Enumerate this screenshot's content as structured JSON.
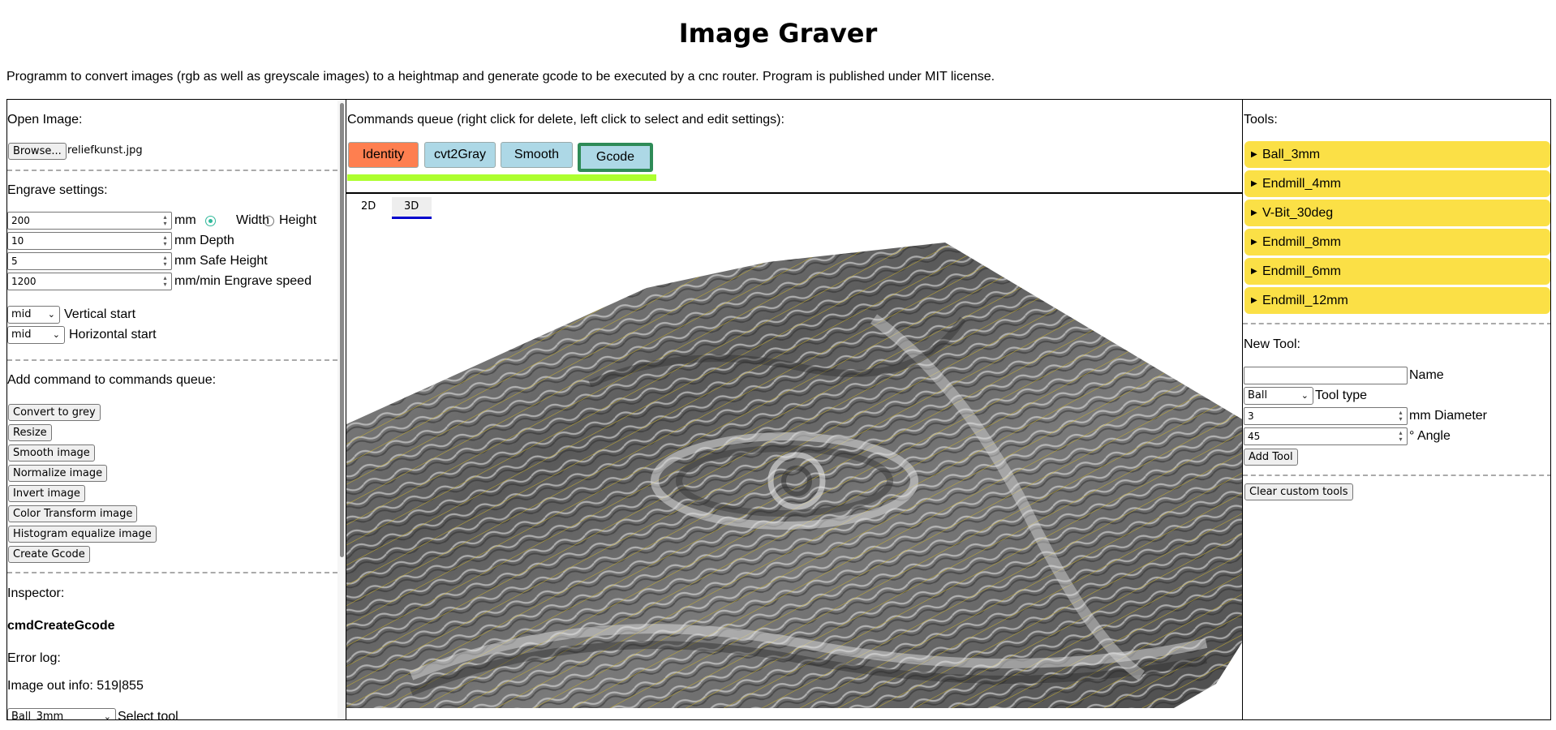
{
  "title": "Image Graver",
  "description": "Programm to convert images (rgb as well as greyscale images) to a heightmap and generate gcode to be executed by a cnc router. Program is published under MIT license.",
  "left": {
    "open_image_label": "Open Image:",
    "browse_label": "Browse...",
    "file_name": "reliefkunst.jpg",
    "engrave_settings_label": "Engrave settings:",
    "size_value": "200",
    "size_unit": "mm",
    "width_label": "Width",
    "height_label": "Height",
    "depth_value": "10",
    "depth_label": "mm Depth",
    "safe_height_value": "5",
    "safe_height_label": "mm Safe Height",
    "speed_value": "1200",
    "speed_label": "mm/min Engrave speed",
    "vertical_start_value": "mid",
    "vertical_start_label": "Vertical start",
    "horizontal_start_value": "mid",
    "horizontal_start_label": "Horizontal start",
    "add_command_label": "Add command to commands queue:",
    "commands": [
      "Convert to grey",
      "Resize",
      "Smooth image",
      "Normalize image",
      "Invert image",
      "Color Transform image",
      "Histogram equalize image",
      "Create Gcode"
    ],
    "inspector_label": "Inspector:",
    "inspector_cmd": "cmdCreateGcode",
    "error_log_label": "Error log:",
    "image_out_info": "Image out info: 519|855",
    "select_tool_value": "Ball_3mm",
    "select_tool_label": "Select tool"
  },
  "middle": {
    "queue_label": "Commands queue (right click for delete, left click to select and edit settings):",
    "queue": [
      "Identity",
      "cvt2Gray",
      "Smooth",
      "Gcode"
    ],
    "tabs": [
      "2D",
      "3D"
    ],
    "active_tab": "3D"
  },
  "right": {
    "tools_label": "Tools:",
    "tools": [
      "Ball_3mm",
      "Endmill_4mm",
      "V-Bit_30deg",
      "Endmill_8mm",
      "Endmill_6mm",
      "Endmill_12mm"
    ],
    "new_tool_label": "New Tool:",
    "name_label": "Name",
    "name_value": "",
    "tool_type_value": "Ball",
    "tool_type_label": "Tool type",
    "diameter_value": "3",
    "diameter_label": "mm Diameter",
    "angle_value": "45",
    "angle_label": "° Angle",
    "add_tool_label": "Add Tool",
    "clear_label": "Clear custom tools"
  },
  "colors": {
    "identity": "#fe7f50",
    "queue_item": "#add8e6",
    "selected_border": "#2e8b57",
    "progress": "#adff2f",
    "tool_bg": "#fbe046",
    "tab_underline": "#0000cd",
    "radio_checked": "#2fb99a"
  }
}
